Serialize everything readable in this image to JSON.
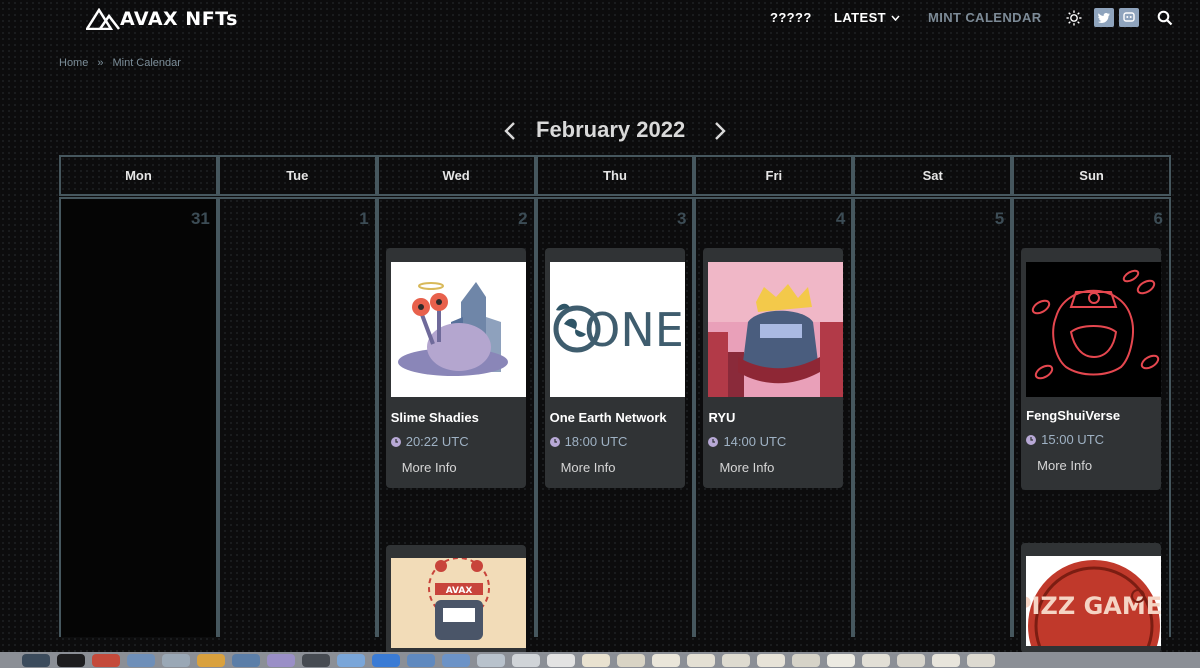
{
  "header": {
    "logo_text": "AVAX NFTs",
    "nav": {
      "unknown": "?????",
      "latest": "LATEST",
      "mint_calendar": "MINT CALENDAR"
    },
    "icons": [
      "sun-icon",
      "twitter-icon",
      "discord-icon",
      "search-icon"
    ]
  },
  "breadcrumb": {
    "home": "Home",
    "separator": "»",
    "current": "Mint Calendar"
  },
  "calendar": {
    "month_title": "February 2022",
    "weekdays": [
      "Mon",
      "Tue",
      "Wed",
      "Thu",
      "Fri",
      "Sat",
      "Sun"
    ],
    "day_numbers": [
      "31",
      "1",
      "2",
      "3",
      "4",
      "5",
      "6"
    ],
    "events": {
      "wed": {
        "title": "Slime Shadies",
        "time": "20:22 UTC",
        "more": "More Info"
      },
      "thu": {
        "title": "One Earth Network",
        "time": "18:00 UTC",
        "more": "More Info",
        "logo_text": "ONE"
      },
      "fri": {
        "title": "RYU",
        "time": "14:00 UTC",
        "more": "More Info"
      },
      "sun": {
        "title": "FengShuiVerse",
        "time": "15:00 UTC",
        "more": "More Info"
      }
    },
    "second_events": {
      "wed_banner": "AVAX",
      "sun_text": "PIZZ GAME"
    }
  },
  "colors": {
    "background": "#0c0c0d",
    "grid_border": "#46575e",
    "card_bg": "#303335",
    "accent_time": "#9fb2c4"
  }
}
